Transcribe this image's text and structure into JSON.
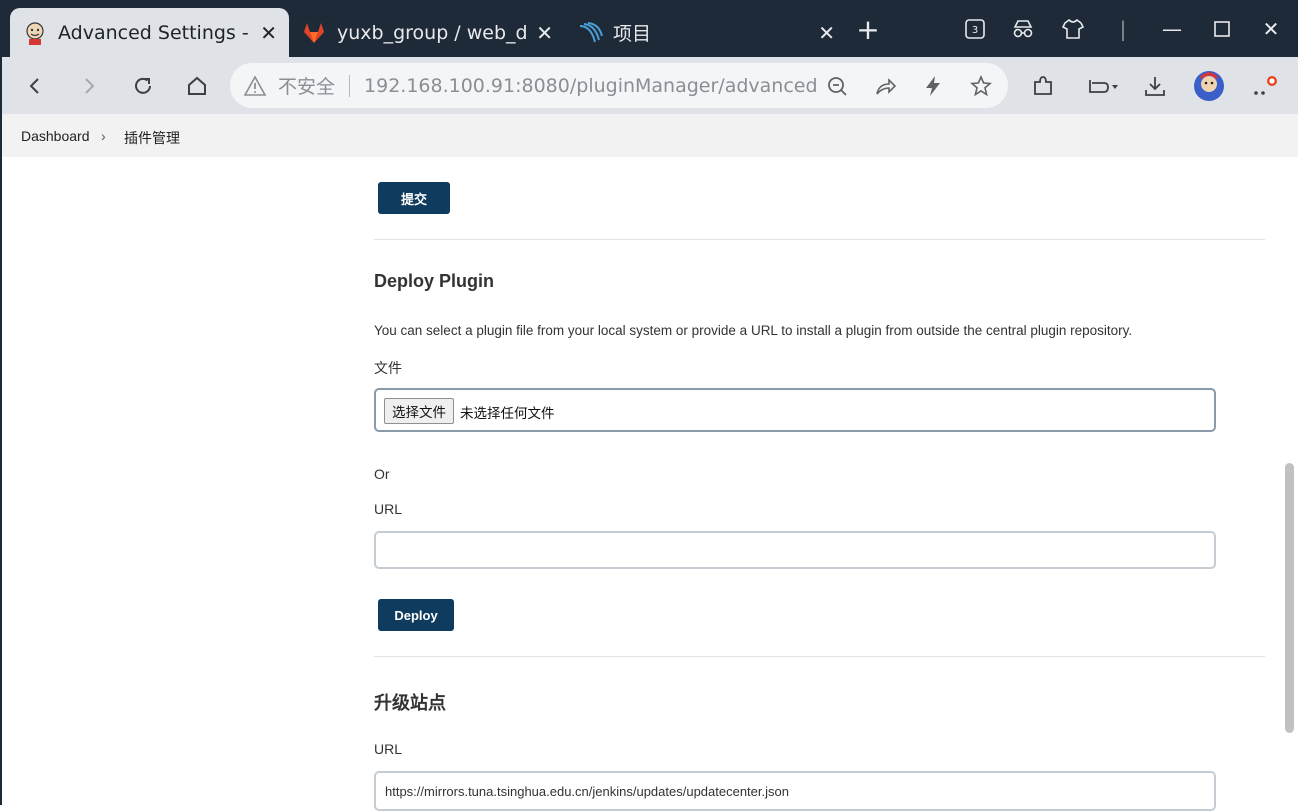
{
  "browser": {
    "tabs": [
      {
        "title": "Advanced Settings - P",
        "favicon": "jenkins-icon",
        "active": true
      },
      {
        "title": "yuxb_group / web_der",
        "favicon": "gitlab-icon",
        "active": false
      },
      {
        "title": "项目",
        "favicon": "app-logo-icon",
        "active": false
      }
    ],
    "tab_counter": "3",
    "address": {
      "security_label": "不安全",
      "url": "192.168.100.91:8080/pluginManager/advanced"
    },
    "colors": {
      "tabbar": "#1f2a38",
      "toolbar": "#dfe3e8",
      "accent_button": "#0e3b5e"
    }
  },
  "breadcrumb": {
    "items": [
      "Dashboard",
      "插件管理"
    ]
  },
  "proxy_section": {
    "submit_label": "提交"
  },
  "deploy_plugin": {
    "title": "Deploy Plugin",
    "description": "You can select a plugin file from your local system or provide a URL to install a plugin from outside the central plugin repository.",
    "file_label": "文件",
    "choose_file_label": "选择文件",
    "no_file_text": "未选择任何文件",
    "or_text": "Or",
    "url_label": "URL",
    "url_value": "",
    "deploy_label": "Deploy"
  },
  "update_site": {
    "title": "升级站点",
    "url_label": "URL",
    "url_value": "https://mirrors.tuna.tsinghua.edu.cn/jenkins/updates/updatecenter.json"
  }
}
